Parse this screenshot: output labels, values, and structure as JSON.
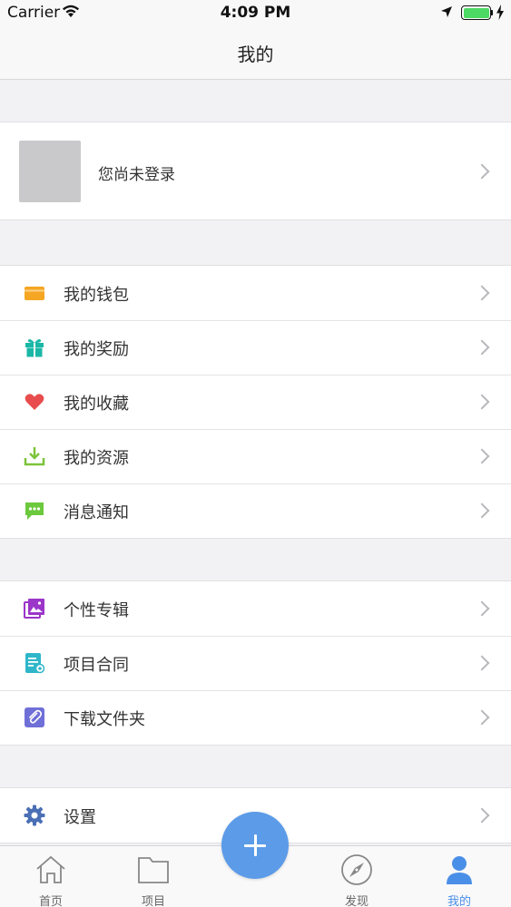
{
  "status_bar": {
    "carrier": "Carrier",
    "time": "4:09 PM",
    "battery_level": 1.0
  },
  "nav": {
    "title": "我的"
  },
  "profile": {
    "text": "您尚未登录"
  },
  "section1": [
    {
      "label": "我的钱包",
      "icon": "wallet-icon",
      "color": "#f5a623"
    },
    {
      "label": "我的奖励",
      "icon": "gift-icon",
      "color": "#1bb7a6"
    },
    {
      "label": "我的收藏",
      "icon": "heart-icon",
      "color": "#e84c4c"
    },
    {
      "label": "我的资源",
      "icon": "download-icon",
      "color": "#7cc43a"
    },
    {
      "label": "消息通知",
      "icon": "message-icon",
      "color": "#6cc93d"
    }
  ],
  "section2": [
    {
      "label": "个性专辑",
      "icon": "album-icon",
      "color": "#9b36c9"
    },
    {
      "label": "项目合同",
      "icon": "contract-icon",
      "color": "#2fb7c9"
    },
    {
      "label": "下载文件夹",
      "icon": "paperclip-icon",
      "color": "#6f6fd8"
    }
  ],
  "section3": [
    {
      "label": "设置",
      "icon": "gear-icon",
      "color": "#4a6fb5"
    }
  ],
  "tabbar": {
    "tabs": [
      {
        "label": "首页",
        "icon": "home-icon",
        "active": false
      },
      {
        "label": "项目",
        "icon": "folder-icon",
        "active": false
      },
      {
        "label": "发现",
        "icon": "compass-icon",
        "active": false
      },
      {
        "label": "我的",
        "icon": "person-icon",
        "active": true
      }
    ],
    "center_button_icon": "plus-icon",
    "active_color": "#4a8fe7"
  }
}
